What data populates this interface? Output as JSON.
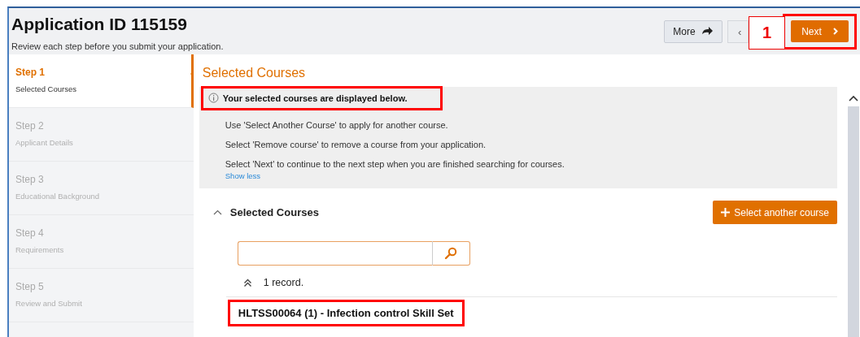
{
  "header": {
    "title": "Application ID 115159",
    "subtitle": "Review each step before you submit your application.",
    "buttons": [
      {
        "label": "More",
        "kind": "more"
      },
      {
        "label": "‹",
        "kind": "prev"
      },
      {
        "label": "Next",
        "kind": "next"
      }
    ],
    "annotation_number": "1"
  },
  "steps": [
    {
      "label": "Step 1",
      "name": "Selected Courses",
      "selected": true
    },
    {
      "label": "Step 2",
      "name": "Applicant Details",
      "selected": false
    },
    {
      "label": "Step 3",
      "name": "Educational Background",
      "selected": false
    },
    {
      "label": "Step 4",
      "name": "Requirements",
      "selected": false
    },
    {
      "label": "Step 5",
      "name": "Review and Submit",
      "selected": false
    }
  ],
  "content": {
    "title": "Selected Courses",
    "info": {
      "heading": "Your selected courses are displayed below.",
      "lines": [
        "Use 'Select Another Course' to apply for another course.",
        "Select 'Remove course' to remove a course from your application.",
        "Select 'Next' to continue to the next step when you are finished searching for courses."
      ],
      "toggle": "Show less"
    },
    "section": {
      "title": "Selected Courses",
      "expanded": true,
      "add_button": "Select another course",
      "record_count": "1 record.",
      "courses": [
        "HLTSS00064 (1) - Infection control Skill Set"
      ]
    }
  }
}
